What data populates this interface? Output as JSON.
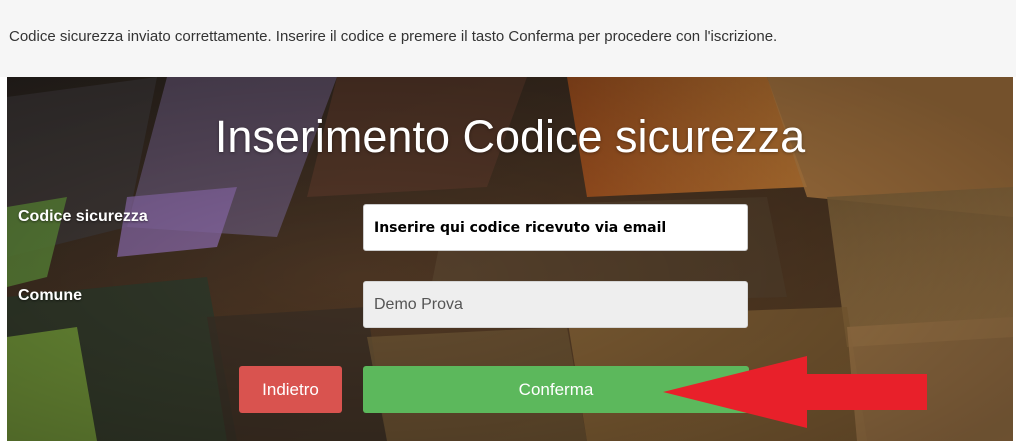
{
  "notice": {
    "message": "Codice sicurezza inviato correttamente. Inserire il codice e premere il tasto Conferma per procedere con l'iscrizione."
  },
  "form": {
    "title": "Inserimento Codice sicurezza",
    "codice_label": "Codice sicurezza",
    "codice_placeholder": "Inserire qui codice ricevuto via email",
    "comune_label": "Comune",
    "comune_value": "Demo Prova"
  },
  "buttons": {
    "back_label": "Indietro",
    "confirm_label": "Conferma"
  },
  "annotation": {
    "arrow_icon": "left-arrow-icon",
    "arrow_color": "#e8202a"
  },
  "colors": {
    "back_button": "#d9534f",
    "confirm_button": "#5cb85c"
  }
}
